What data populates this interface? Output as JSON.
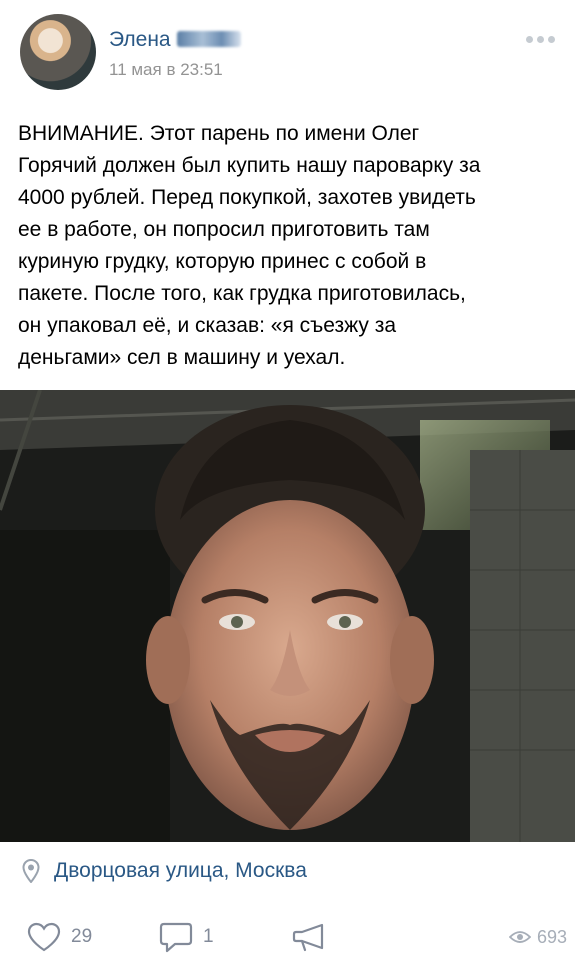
{
  "post": {
    "author": "Элена",
    "date": "11 мая в 23:51",
    "text": "ВНИМАНИЕ. Этот парень по имени Олег\nГорячий должен был купить нашу пароварку за\n4000 рублей. Перед покупкой, захотев увидеть\nее в работе, он попросил приготовить там\nкуриную грудку, которую принес с собой в\nпакете. После того, как грудка приготовилась,\nон упаковал её, и сказав: «я съезжу за\nденьгами» сел в машину и уехал.",
    "location": "Дворцовая улица, Москва"
  },
  "actions": {
    "likes": "29",
    "comments": "1",
    "views": "693"
  },
  "colors": {
    "link": "#2a5885",
    "meta": "#939393",
    "action": "#828a99"
  },
  "icons": [
    "more-icon",
    "pin-icon",
    "heart-icon",
    "comment-icon",
    "share-icon",
    "eye-icon"
  ]
}
